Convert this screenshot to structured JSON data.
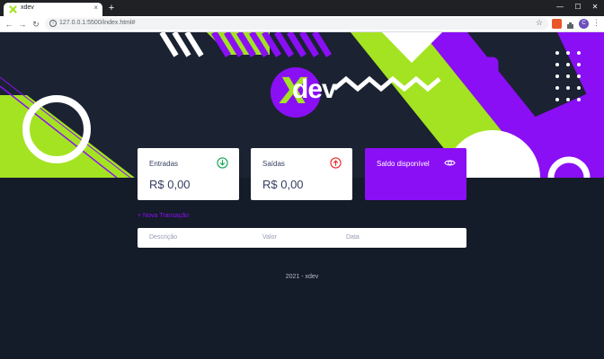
{
  "browser": {
    "tab_title": "xdev",
    "tab_close": "×",
    "new_tab": "+",
    "minimize": "—",
    "maximize": "☐",
    "close": "✕",
    "back": "←",
    "forward": "→",
    "reload": "↻",
    "info": "i",
    "url": "127.0.0.1:5500/index.html#",
    "star": "☆",
    "avatar": "C",
    "menu": "⋮"
  },
  "logo": {
    "mark": "X",
    "text": "dev"
  },
  "cards": [
    {
      "title": "Entradas",
      "value": "R$ 0,00",
      "icon": "arrow-down-circle-icon",
      "icon_color": "#12a454"
    },
    {
      "title": "Saídas",
      "value": "R$ 0,00",
      "icon": "arrow-up-circle-icon",
      "icon_color": "#e92929"
    },
    {
      "title": "Saldo disponível",
      "icon": "eye-icon",
      "bg_color": "#8a0ff5"
    }
  ],
  "new_transaction": "+ Nova Transação",
  "table": {
    "headers": [
      "Descrição",
      "Valor",
      "Data"
    ]
  },
  "footer": "2021 - xdev",
  "colors": {
    "purple": "#8a0ff5",
    "lime": "#a4e322",
    "dark_bg": "#141b29",
    "text": "#363f5f"
  }
}
